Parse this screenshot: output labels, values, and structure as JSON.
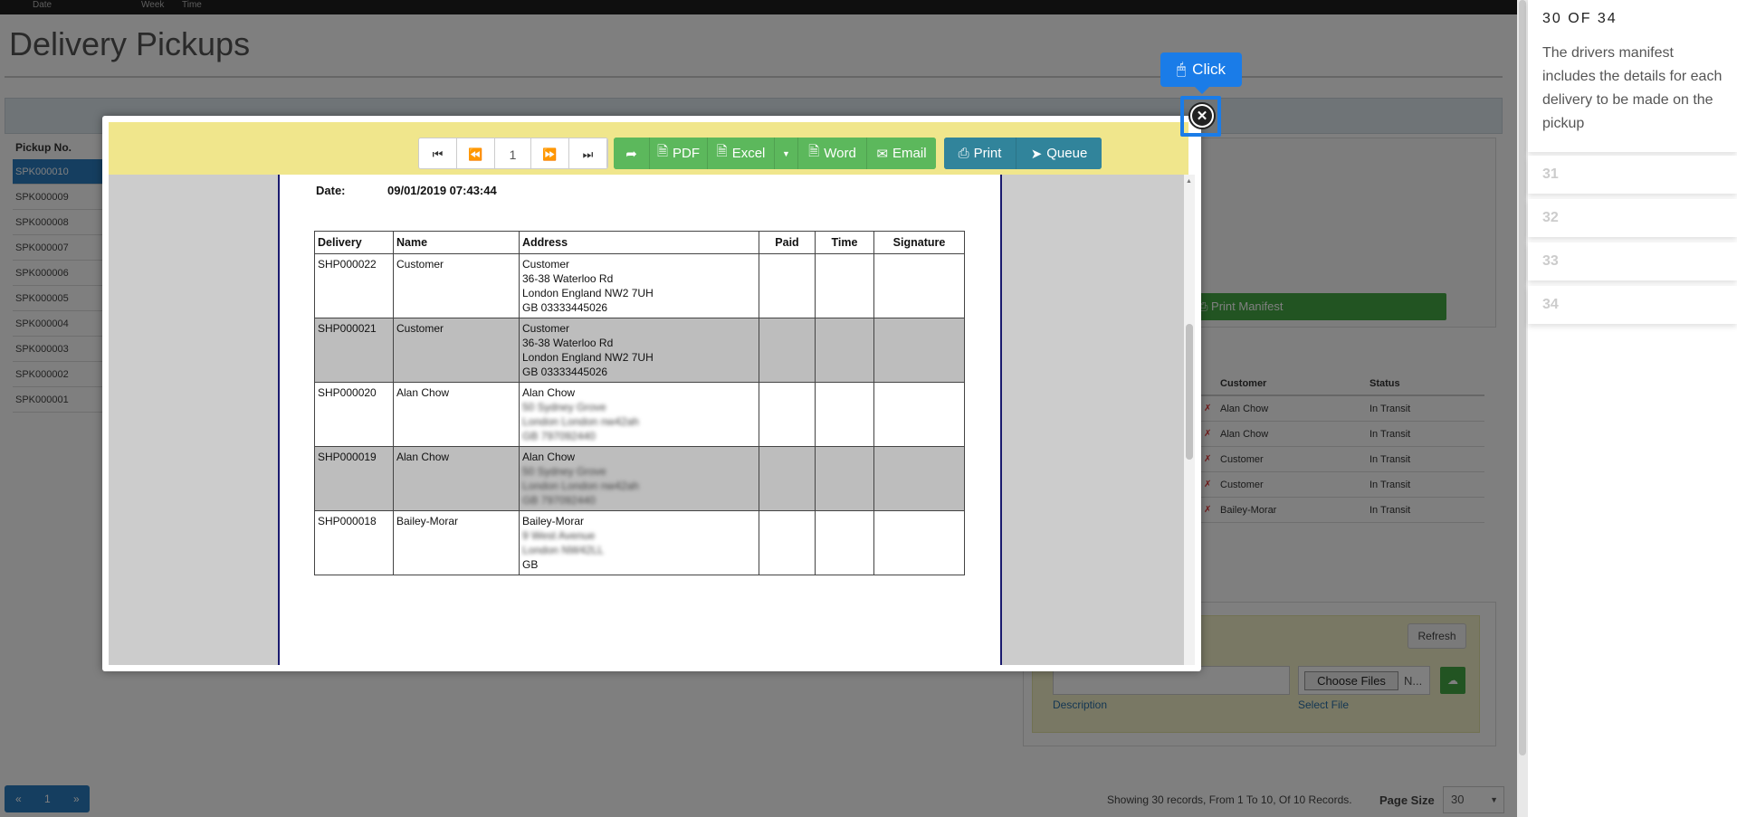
{
  "topbar": {
    "date": "Date",
    "week": "Week",
    "time": "Time"
  },
  "page_title": "Delivery Pickups",
  "pickups": {
    "header": "Pickup No.",
    "rows": [
      "SPK000010",
      "SPK000009",
      "SPK000008",
      "SPK000007",
      "SPK000006",
      "SPK000005",
      "SPK000004",
      "SPK000003",
      "SPK000002",
      "SPK000001"
    ]
  },
  "print_manifest_label": "Print Manifest",
  "shipments": {
    "headers": {
      "customer": "Customer",
      "status": "Status"
    },
    "rows": [
      {
        "customer": "Alan Chow",
        "status": "In Transit"
      },
      {
        "customer": "Alan Chow",
        "status": "In Transit"
      },
      {
        "customer": "Customer",
        "status": "In Transit"
      },
      {
        "customer": "Customer",
        "status": "In Transit"
      },
      {
        "customer": "Bailey-Morar",
        "status": "In Transit"
      }
    ]
  },
  "upload": {
    "refresh_label": "Refresh",
    "choose_files_label": "Choose Files",
    "file_name_hint": "N...",
    "description_label": "Description",
    "select_file_label": "Select File"
  },
  "pager": {
    "prev": "«",
    "page": "1",
    "next": "»"
  },
  "records_text": "Showing 30 records, From 1 To 10, Of 10 Records.",
  "page_size": {
    "label": "Page Size",
    "value": "30"
  },
  "viewer": {
    "page_number": "1",
    "pdf_label": "PDF",
    "excel_label": "Excel",
    "word_label": "Word",
    "email_label": "Email",
    "print_label": "Print",
    "queue_label": "Queue"
  },
  "report": {
    "date_label": "Date:",
    "date_value": "09/01/2019 07:43:44",
    "columns": {
      "delivery": "Delivery",
      "name": "Name",
      "address": "Address",
      "paid": "Paid",
      "time": "Time",
      "signature": "Signature"
    },
    "rows": [
      {
        "delivery": "SHP000022",
        "name": "Customer",
        "addr1": "Customer",
        "addr2": "36-38 Waterloo Rd",
        "addr3": "London England NW2 7UH",
        "addr4": "GB 03333445026"
      },
      {
        "delivery": "SHP000021",
        "name": "Customer",
        "addr1": "Customer",
        "addr2": "36-38 Waterloo Rd",
        "addr3": "London England NW2 7UH",
        "addr4": "GB 03333445026"
      },
      {
        "delivery": "SHP000020",
        "name": "Alan Chow",
        "addr1": "Alan Chow",
        "addr2": "50 Sydney Grove",
        "addr3": "London London nw42ah",
        "addr4": "GB 797092440"
      },
      {
        "delivery": "SHP000019",
        "name": "Alan Chow",
        "addr1": "Alan Chow",
        "addr2": "50 Sydney Grove",
        "addr3": "London London nw42ah",
        "addr4": "GB 797092440"
      },
      {
        "delivery": "SHP000018",
        "name": "Bailey-Morar",
        "addr1": "Bailey-Morar",
        "addr2": "9 West Avenue",
        "addr3": "London NW42LL",
        "addr4": "GB"
      }
    ]
  },
  "tooltip": {
    "label": "Click"
  },
  "guide": {
    "counter": "30 OF 34",
    "text": "The drivers manifest includes the details for each delivery to be made on the pickup",
    "upcoming": [
      "31",
      "32",
      "33",
      "34"
    ]
  },
  "colors": {
    "accent": "#1a7ce8",
    "toolbar_bg": "#f0e68c",
    "green": "#5cb85c",
    "teal": "#31849b"
  }
}
